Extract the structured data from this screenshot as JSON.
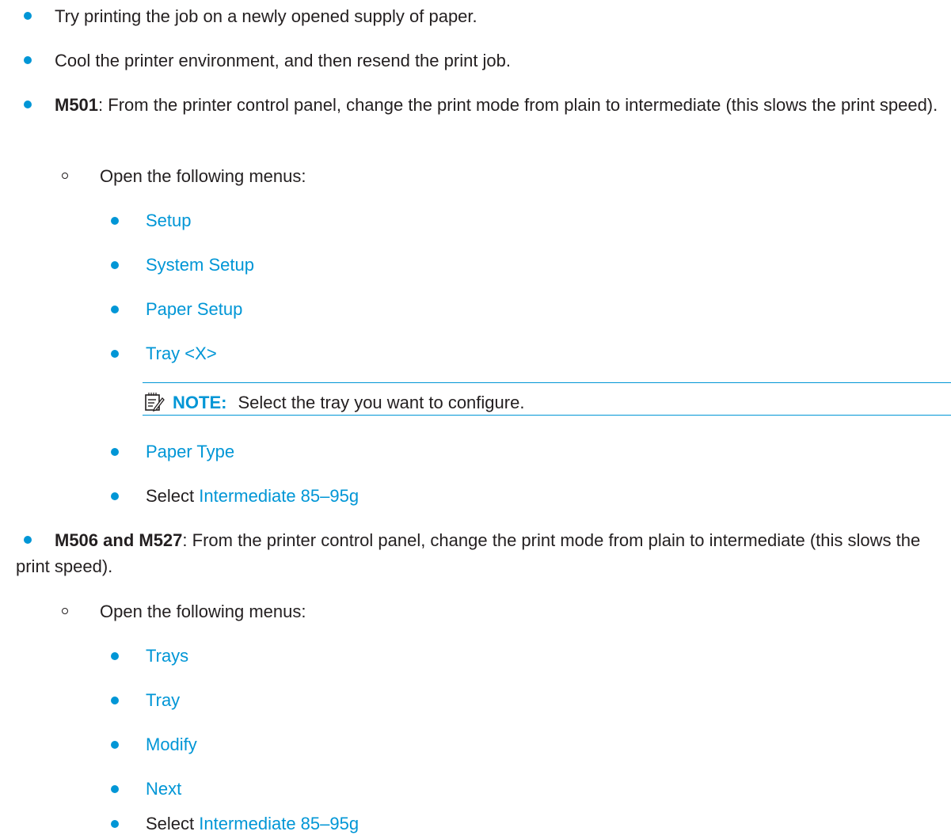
{
  "items": {
    "i1": "Try printing the job on a newly opened supply of paper.",
    "i2": "Cool the printer environment, and then resend the print job.",
    "i3_model": "M501",
    "i3_rest": ": From the printer control panel, change the print mode from plain to intermediate (this slows the print speed).",
    "i3_sub": "Open the following menus:",
    "i3_menus": [
      "Setup",
      "System Setup",
      "Paper Setup",
      "Tray <X>"
    ],
    "note_label": "NOTE:",
    "note_text": "Select the tray you want to configure.",
    "i3_menus2": [
      "Paper Type"
    ],
    "select_prefix": "Select",
    "select_value": "Intermediate 85–95g",
    "i4_model": "M506 and M527",
    "i4_rest": ": From the printer control panel, change the print mode from plain to intermediate (this slows the print speed).",
    "i4_sub": "Open the following menus:",
    "i4_menus": [
      "Trays",
      "Tray",
      "Modify",
      "Next"
    ],
    "select_prefix2": "Select",
    "select_value2": "Intermediate 85–95g"
  },
  "colors": {
    "accent": "#0096d6",
    "text": "#231f20"
  }
}
